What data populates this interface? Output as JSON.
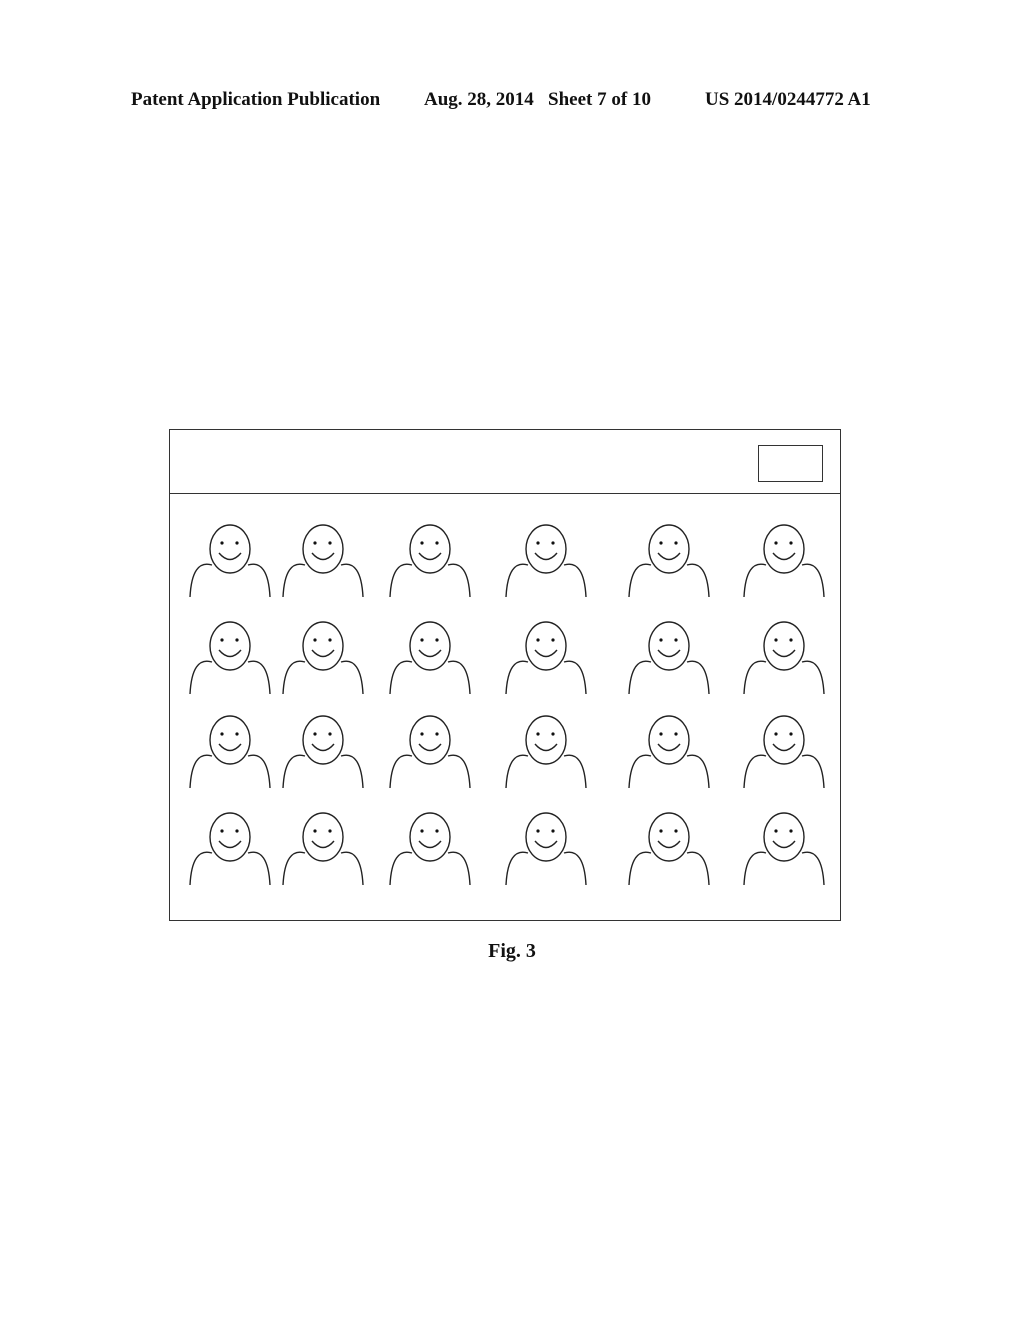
{
  "header": {
    "publication_type": "Patent Application Publication",
    "date_sheet": "Aug. 28, 2014   Sheet 7 of 10",
    "publication_number": "US 2014/0244772 A1"
  },
  "figure": {
    "caption": "Fig. 3",
    "window": {
      "titlebar_button_label": "",
      "avatar_grid": {
        "rows": 4,
        "columns": 6,
        "icon": "smiley-person-icon"
      }
    }
  }
}
